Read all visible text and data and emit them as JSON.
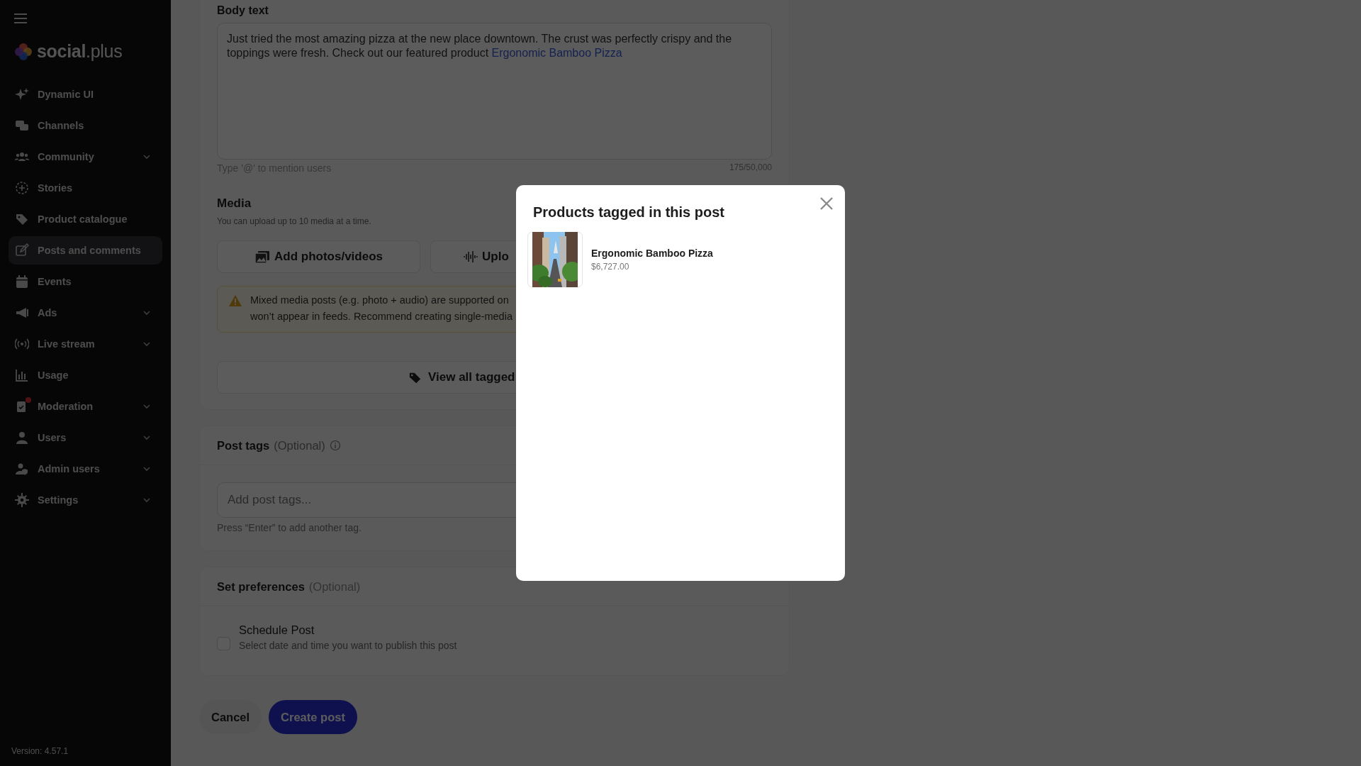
{
  "sidebar": {
    "logo": "**social**.plus",
    "items": [
      {
        "label": "Dynamic UI",
        "kind": "link",
        "selected": false,
        "notification": false
      },
      {
        "label": "Channels",
        "kind": "link",
        "selected": false,
        "notification": false
      },
      {
        "label": "Community",
        "kind": "group",
        "selected": false,
        "notification": false
      },
      {
        "label": "Stories",
        "kind": "link",
        "selected": false,
        "notification": false
      },
      {
        "label": "Product catalogue",
        "kind": "link",
        "selected": false,
        "notification": false
      },
      {
        "label": "Posts and comments",
        "kind": "link",
        "selected": true,
        "notification": false
      },
      {
        "label": "Events",
        "kind": "link",
        "selected": false,
        "notification": false
      },
      {
        "label": "Ads",
        "kind": "group",
        "selected": false,
        "notification": false
      },
      {
        "label": "Live stream",
        "kind": "group",
        "selected": false,
        "notification": false
      },
      {
        "label": "Usage",
        "kind": "link",
        "selected": false,
        "notification": false
      },
      {
        "label": "Moderation",
        "kind": "group",
        "selected": false,
        "notification": true
      },
      {
        "label": "Users",
        "kind": "group",
        "selected": false,
        "notification": false
      },
      {
        "label": "Admin users",
        "kind": "group",
        "selected": false,
        "notification": false
      },
      {
        "label": "Settings",
        "kind": "group",
        "selected": false,
        "notification": false
      }
    ],
    "version": "Version: 4.57.1"
  },
  "body_text": {
    "label": "Body text",
    "text": "Just tried the most amazing pizza at the new place downtown. The crust was perfectly crispy and the toppings were fresh. Check out our featured product ",
    "mention": "Ergonomic Bamboo Pizza",
    "hint": "Type '@' to mention users",
    "counter": "175/50,000"
  },
  "media": {
    "title": "Media",
    "subtitle": "You can upload up to 10 media at a time.",
    "buttons": [
      "Add photos/videos",
      "Uplo"
    ],
    "warning_lines": [
      "Mixed media posts (e.g. photo + audio) are supported on",
      "won’t appear in feeds. Recommend creating single-media"
    ],
    "view_tagged": "View all tagged"
  },
  "post_tags": {
    "title": "Post tags",
    "optional": "(Optional)",
    "placeholder": "Add post tags...",
    "hint": "Press “Enter” to add another tag."
  },
  "preferences": {
    "title": "Set preferences",
    "optional": "(Optional)",
    "schedule": {
      "label": "Schedule Post",
      "description": "Select date and time you want to publish this post",
      "checked": false
    }
  },
  "actions": [
    "Cancel",
    "Create post"
  ],
  "modal": {
    "title": "Products tagged in this post",
    "products": [
      {
        "name": "Ergonomic Bamboo Pizza",
        "price": "$6,727.00"
      }
    ]
  }
}
